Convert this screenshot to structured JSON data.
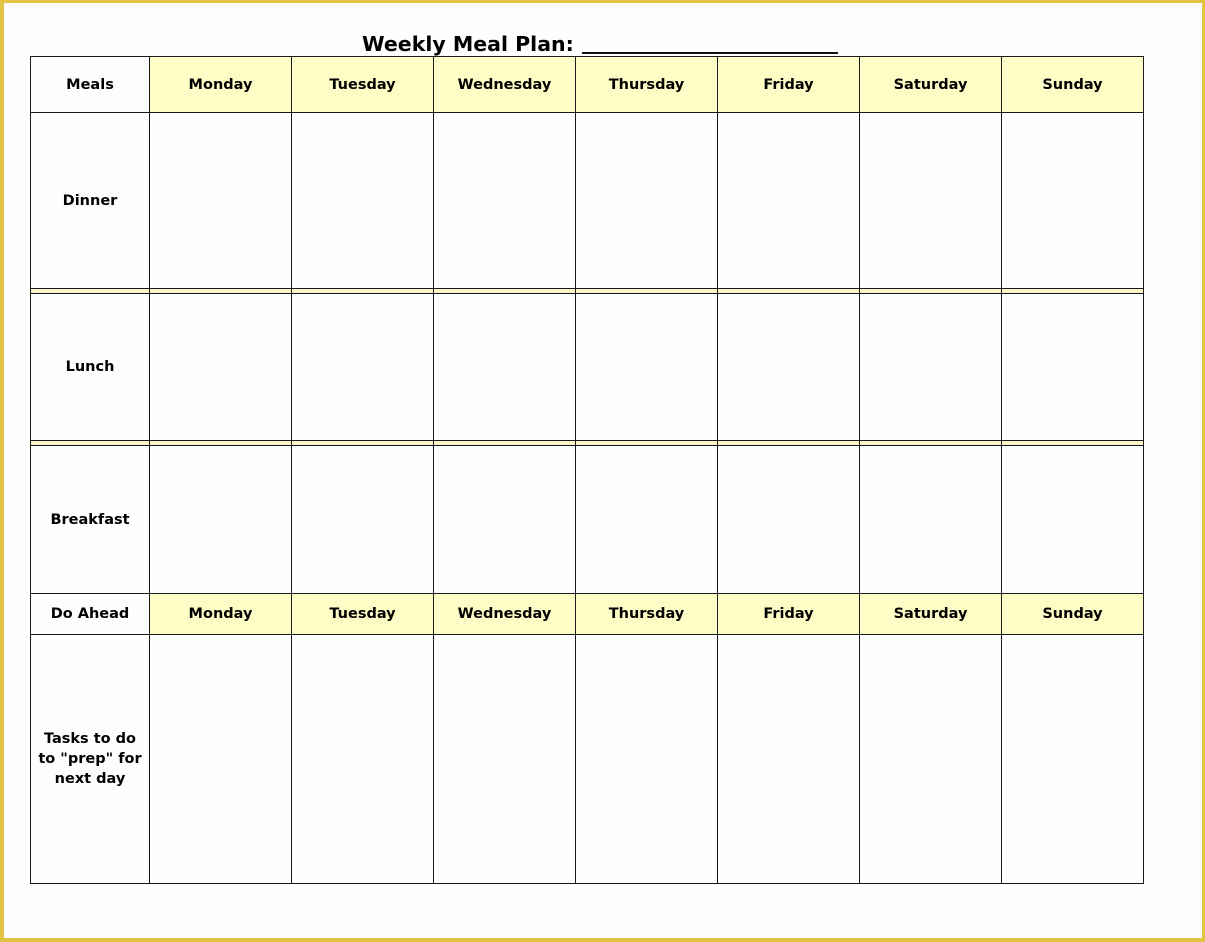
{
  "document": {
    "title": "Weekly Meal Plan:",
    "title_blank": ""
  },
  "header": {
    "corner_label": "Meals",
    "days": [
      "Monday",
      "Tuesday",
      "Wednesday",
      "Thursday",
      "Friday",
      "Saturday",
      "Sunday"
    ]
  },
  "meal_rows": [
    {
      "label": "Dinner",
      "cells": [
        "",
        "",
        "",
        "",
        "",
        "",
        ""
      ]
    },
    {
      "label": "Lunch",
      "cells": [
        "",
        "",
        "",
        "",
        "",
        "",
        ""
      ]
    },
    {
      "label": "Breakfast",
      "cells": [
        "",
        "",
        "",
        "",
        "",
        "",
        ""
      ]
    }
  ],
  "do_ahead": {
    "corner_label": "Do Ahead",
    "days": [
      "Monday",
      "Tuesday",
      "Wednesday",
      "Thursday",
      "Friday",
      "Saturday",
      "Sunday"
    ],
    "row_label_lines": [
      "Tasks to do",
      "to \"prep\" for",
      "next day"
    ],
    "cells": [
      "",
      "",
      "",
      "",
      "",
      "",
      ""
    ]
  },
  "colors": {
    "header_fill": "#fefdc6",
    "frame_border": "#e2c443",
    "band_fill": "#fdf6cc"
  }
}
